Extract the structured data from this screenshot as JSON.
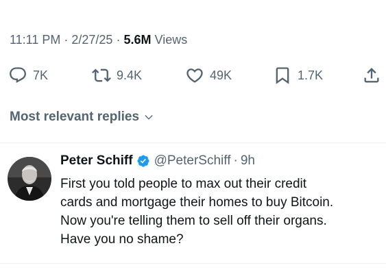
{
  "tweet": {
    "time": "11:11 PM",
    "date": "2/27/25",
    "views_count": "5.6M",
    "views_label": "Views"
  },
  "actions": {
    "reply_count": "7K",
    "retweet_count": "9.4K",
    "like_count": "49K",
    "bookmark_count": "1.7K"
  },
  "replies_sort_label": "Most relevant replies",
  "reply": {
    "name": "Peter Schiff",
    "handle": "@PeterSchiff",
    "time": "9h",
    "lines": [
      "First you told people to max out their credit",
      "cards and mortgage their homes to buy Bitcoin.",
      "Now you're telling them to sell off their organs.",
      "Have you no shame?"
    ]
  },
  "colors": {
    "secondary_text": "#536471",
    "primary_text": "#0f1419",
    "verified_blue": "#1d9bf0",
    "divider": "#eff3f4"
  },
  "icons": {
    "reply": "reply-icon",
    "retweet": "retweet-icon",
    "like": "heart-icon",
    "bookmark": "bookmark-icon",
    "share": "share-icon",
    "verified": "verified-badge-icon",
    "sort": "chevron-down-icon"
  }
}
